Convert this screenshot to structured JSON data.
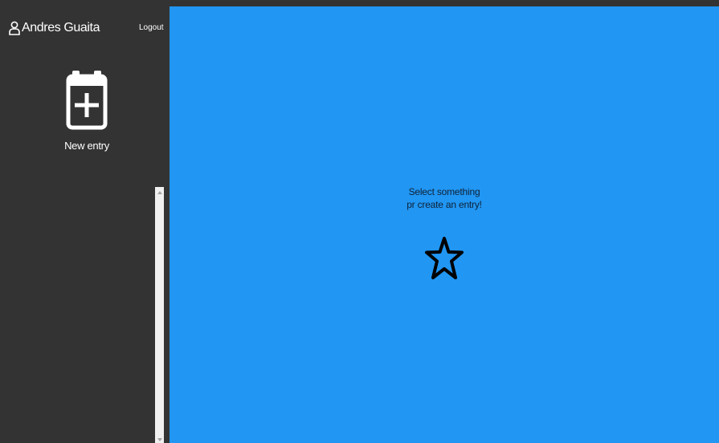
{
  "sidebar": {
    "user_name": "Andres Guaita",
    "logout_label": "Logout",
    "new_entry_label": "New entry",
    "icons": {
      "user": "user-icon",
      "new_entry": "calendar-plus-icon"
    }
  },
  "main": {
    "message_line1": "Select something",
    "message_line2": "pr create an entry!",
    "icon": "star-icon"
  },
  "colors": {
    "sidebar_bg": "#333333",
    "main_bg": "#2196f3",
    "sidebar_text": "#ffffff",
    "main_text": "#0f2236"
  }
}
